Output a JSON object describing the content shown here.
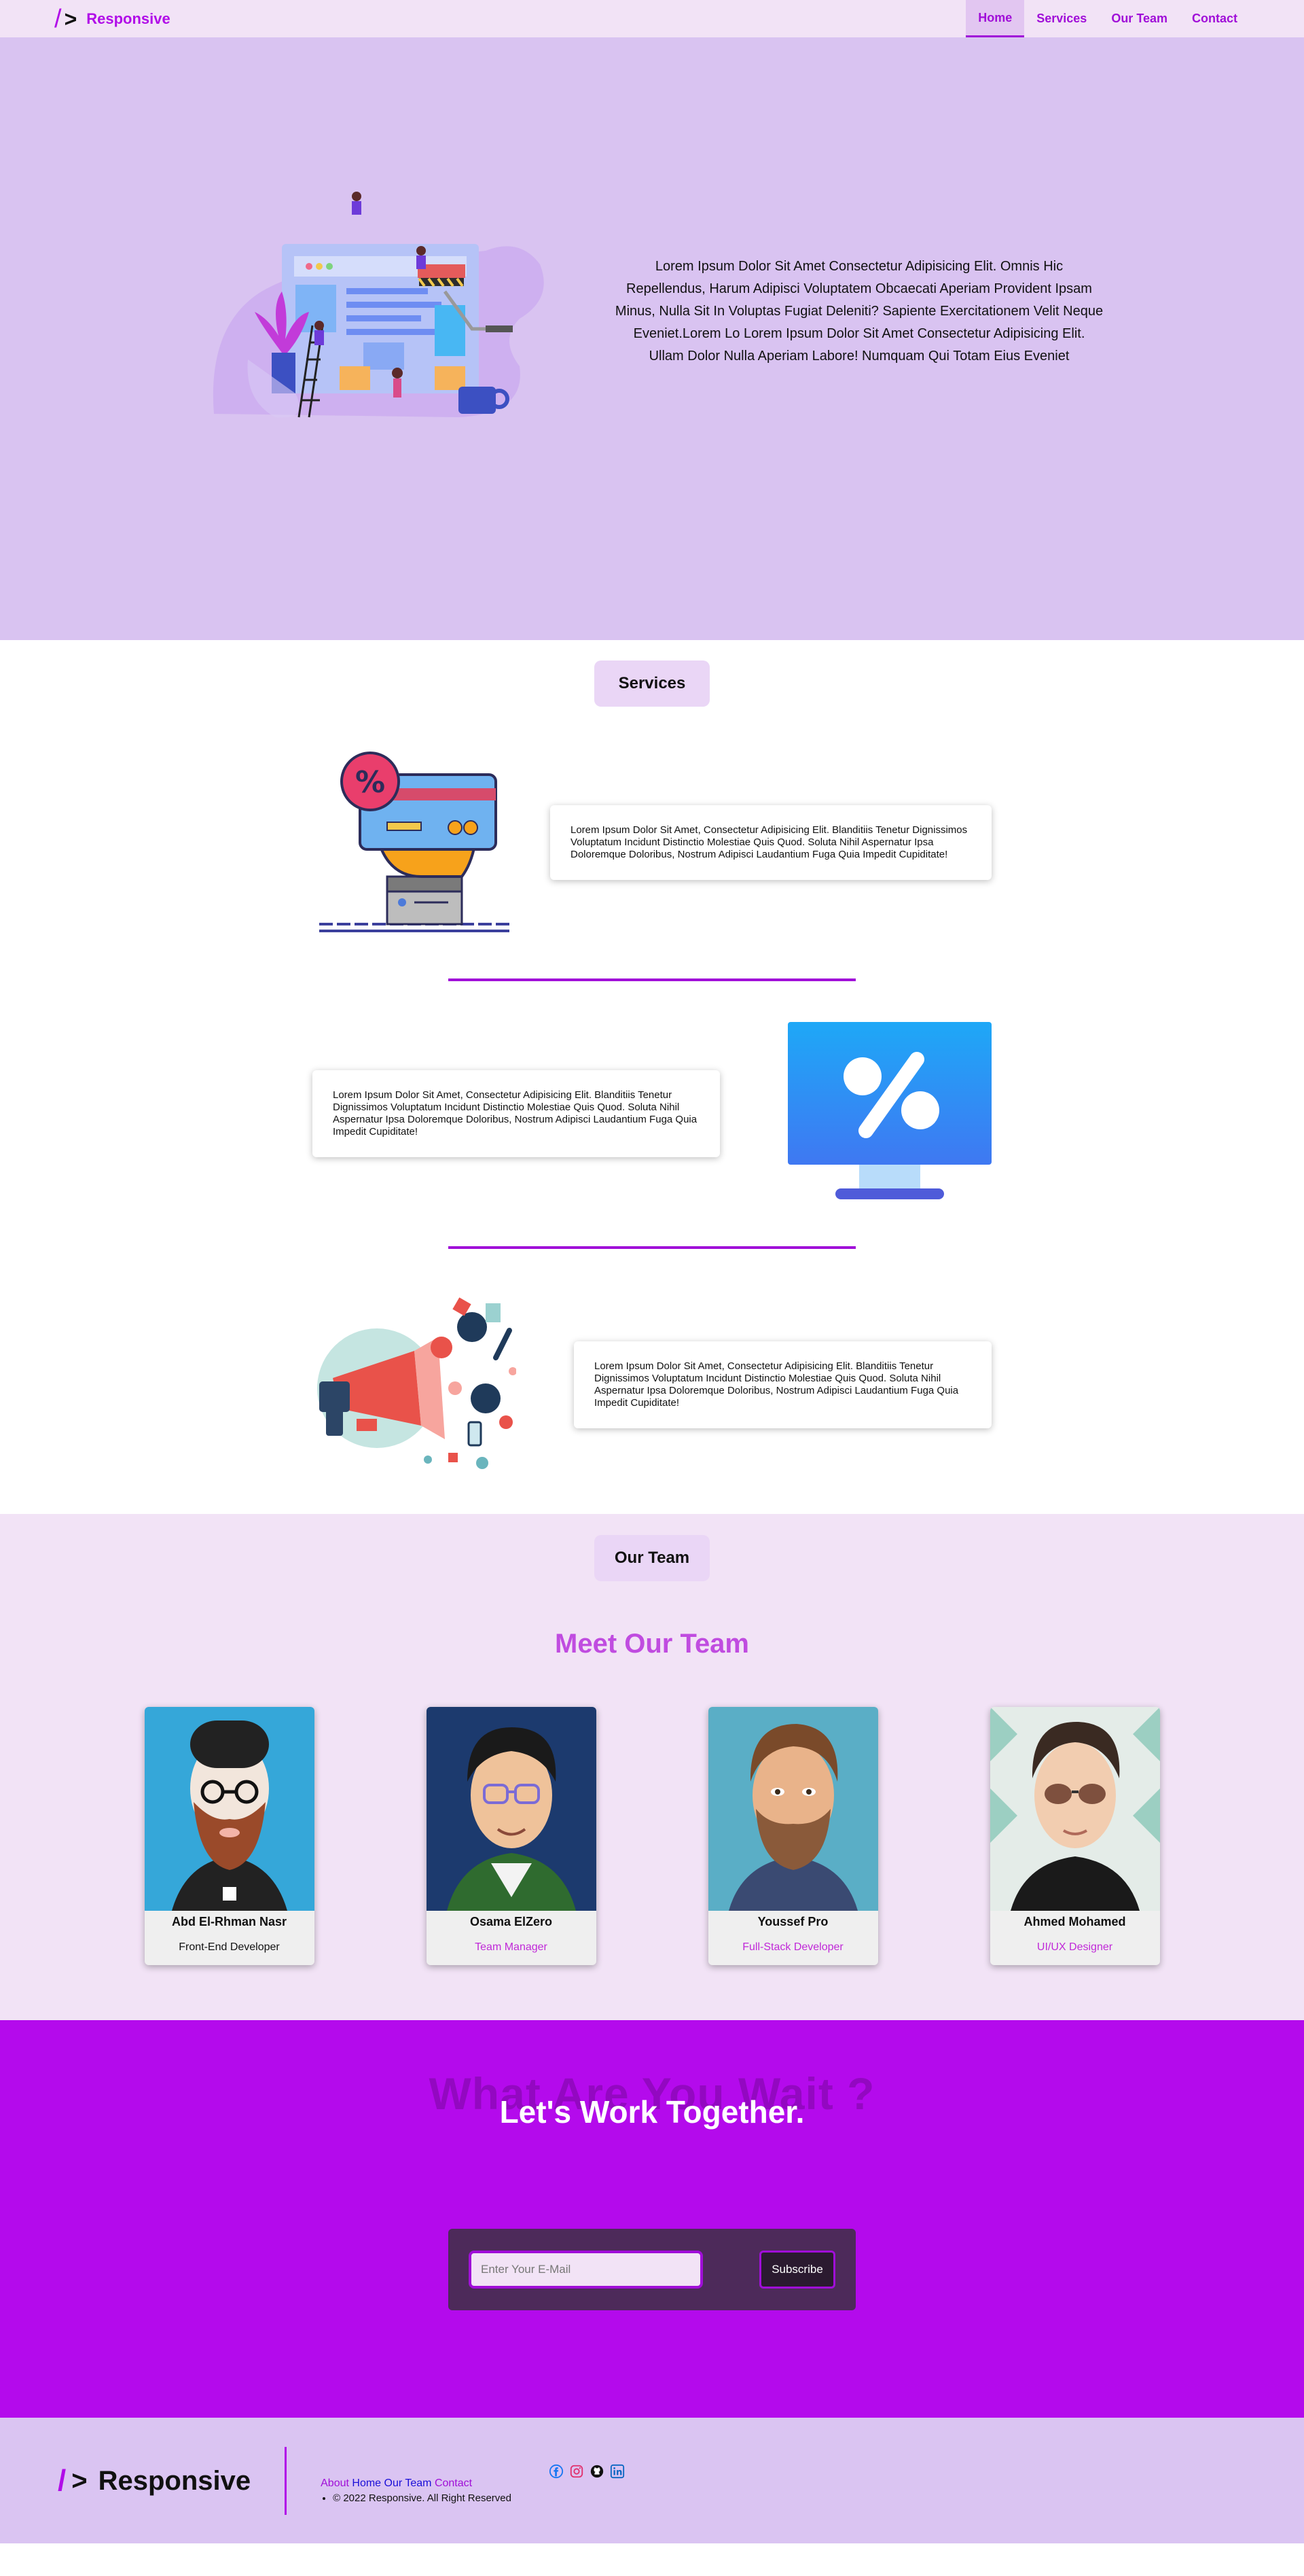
{
  "header": {
    "logo_slash": "/",
    "logo_gt": ">",
    "logo_text": "Responsive",
    "nav": [
      {
        "label": "Home",
        "active": true
      },
      {
        "label": "Services",
        "active": false
      },
      {
        "label": "Our Team",
        "active": false
      },
      {
        "label": "Contact",
        "active": false
      }
    ]
  },
  "hero": {
    "text": "Lorem Ipsum Dolor Sit Amet Consectetur Adipisicing Elit. Omnis Hic Repellendus, Harum Adipisci Voluptatem Obcaecati Aperiam Provident Ipsam Minus, Nulla Sit In Voluptas Fugiat Deleniti? Sapiente Exercitationem Velit Neque Eveniet.Lorem Lo Lorem Ipsum Dolor Sit Amet Consectetur Adipisicing Elit. Ullam Dolor Nulla Aperiam Labore! Numquam Qui Totam Eius Eveniet"
  },
  "services": {
    "title": "Services",
    "items": [
      {
        "text": "Lorem Ipsum Dolor Sit Amet, Consectetur Adipisicing Elit. Blanditiis Tenetur Dignissimos Voluptatum Incidunt Distinctio Molestiae Quis Quod. Soluta Nihil Aspernatur Ipsa Doloremque Doloribus, Nostrum Adipisci Laudantium Fuga Quia Impedit Cupiditate!"
      },
      {
        "text": "Lorem Ipsum Dolor Sit Amet, Consectetur Adipisicing Elit. Blanditiis Tenetur Dignissimos Voluptatum Incidunt Distinctio Molestiae Quis Quod. Soluta Nihil Aspernatur Ipsa Doloremque Doloribus, Nostrum Adipisci Laudantium Fuga Quia Impedit Cupiditate!"
      },
      {
        "text": "Lorem Ipsum Dolor Sit Amet, Consectetur Adipisicing Elit. Blanditiis Tenetur Dignissimos Voluptatum Incidunt Distinctio Molestiae Quis Quod. Soluta Nihil Aspernatur Ipsa Doloremque Doloribus, Nostrum Adipisci Laudantium Fuga Quia Impedit Cupiditate!"
      }
    ]
  },
  "team": {
    "title": "Our Team",
    "heading": "Meet Our Team",
    "members": [
      {
        "name": "Abd El-Rhman Nasr",
        "role": "Front-End Developer"
      },
      {
        "name": "Osama ElZero",
        "role": "Team Manager"
      },
      {
        "name": "Youssef Pro",
        "role": "Full-Stack Developer"
      },
      {
        "name": "Ahmed Mohamed",
        "role": "UI/UX Designer"
      }
    ]
  },
  "cta": {
    "ghost_text": "What Are You Wait ?",
    "title": "Let's Work Together.",
    "email_placeholder": "Enter Your E-Mail",
    "subscribe_label": "Subscribe"
  },
  "footer": {
    "logo_slash": "/",
    "logo_gt": ">",
    "logo_text": "Responsive",
    "links": {
      "about": "About",
      "home": "Home",
      "team": "Our Team",
      "contact": "Contact"
    },
    "copyright": "© 2022 Responsive. All Right Reserved",
    "icons": [
      "facebook-icon",
      "instagram-icon",
      "github-icon",
      "linkedin-icon"
    ]
  },
  "colors": {
    "accent": "#b10ce8",
    "header_bg": "#f2e3f6",
    "hero_bg": "#d9c3f1",
    "cta_bg": "#b40aec"
  }
}
